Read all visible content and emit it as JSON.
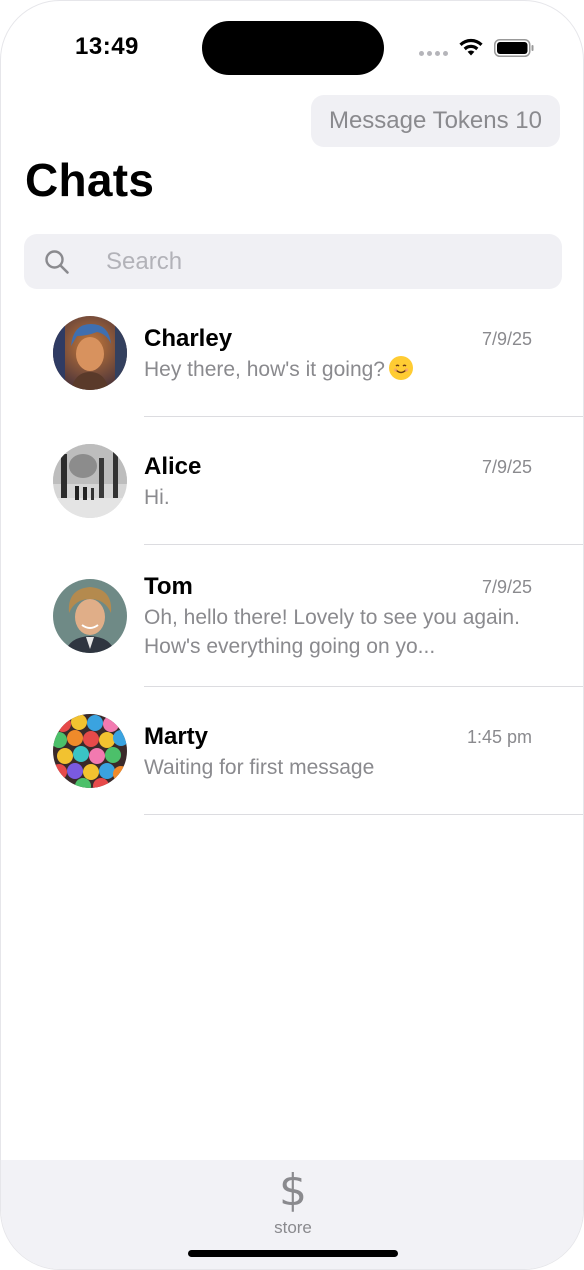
{
  "status_bar": {
    "time": "13:49"
  },
  "header": {
    "tokens_label": "Message Tokens 10",
    "title": "Chats"
  },
  "search": {
    "placeholder": "Search",
    "value": ""
  },
  "chats": [
    {
      "name": "Charley",
      "date": "7/9/25",
      "preview": "Hey there, how's it going?",
      "preview_emoji": "smiling-face-emoji",
      "avatar": "charley-avatar"
    },
    {
      "name": "Alice",
      "date": "7/9/25",
      "preview": "Hi.",
      "avatar": "alice-avatar"
    },
    {
      "name": "Tom",
      "date": "7/9/25",
      "preview": "Oh, hello there! Lovely to see you again. How's everything going on yo...",
      "avatar": "tom-avatar"
    },
    {
      "name": "Marty",
      "date": "1:45 pm",
      "preview": "Waiting for first message",
      "avatar": "marty-avatar"
    }
  ],
  "tab_bar": {
    "items": [
      {
        "label": "store",
        "icon": "dollar-icon",
        "glyph": "$"
      }
    ]
  },
  "colors": {
    "secondary_text": "#8a8a8e",
    "pill_background": "#f0f0f4",
    "tab_bar_background": "#f2f2f6"
  }
}
